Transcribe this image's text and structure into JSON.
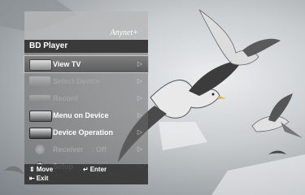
{
  "menu": {
    "brand_logo": "Anynet+",
    "title": "BD Player",
    "items": [
      {
        "label": "View TV",
        "icon": "tv-icon",
        "state": "selected"
      },
      {
        "label": "Select Device",
        "icon": "device-select-icon",
        "state": "disabled"
      },
      {
        "label": "Record",
        "icon": "recorder-icon",
        "state": "disabled"
      },
      {
        "label": "Menu on Device",
        "icon": "device-menu-icon",
        "state": "normal"
      },
      {
        "label": "Device Operation",
        "icon": "device-operation-icon",
        "state": "normal"
      },
      {
        "label": "Receiver    : Off",
        "icon": "receiver-icon",
        "state": "disabled"
      },
      {
        "label": "Setup",
        "icon": "setup-gear-icon",
        "state": "normal"
      }
    ],
    "arrow": "▷"
  },
  "footer": {
    "move": {
      "symbol": "⇕",
      "label": "Move"
    },
    "enter": {
      "symbol": "↵",
      "label": "Enter"
    },
    "exit": {
      "symbol": "⇤",
      "label": "Exit"
    }
  },
  "colors": {
    "selected_highlight": "#6e6e6e",
    "panel": "#696969",
    "title_bar": "#3a3a3a"
  }
}
